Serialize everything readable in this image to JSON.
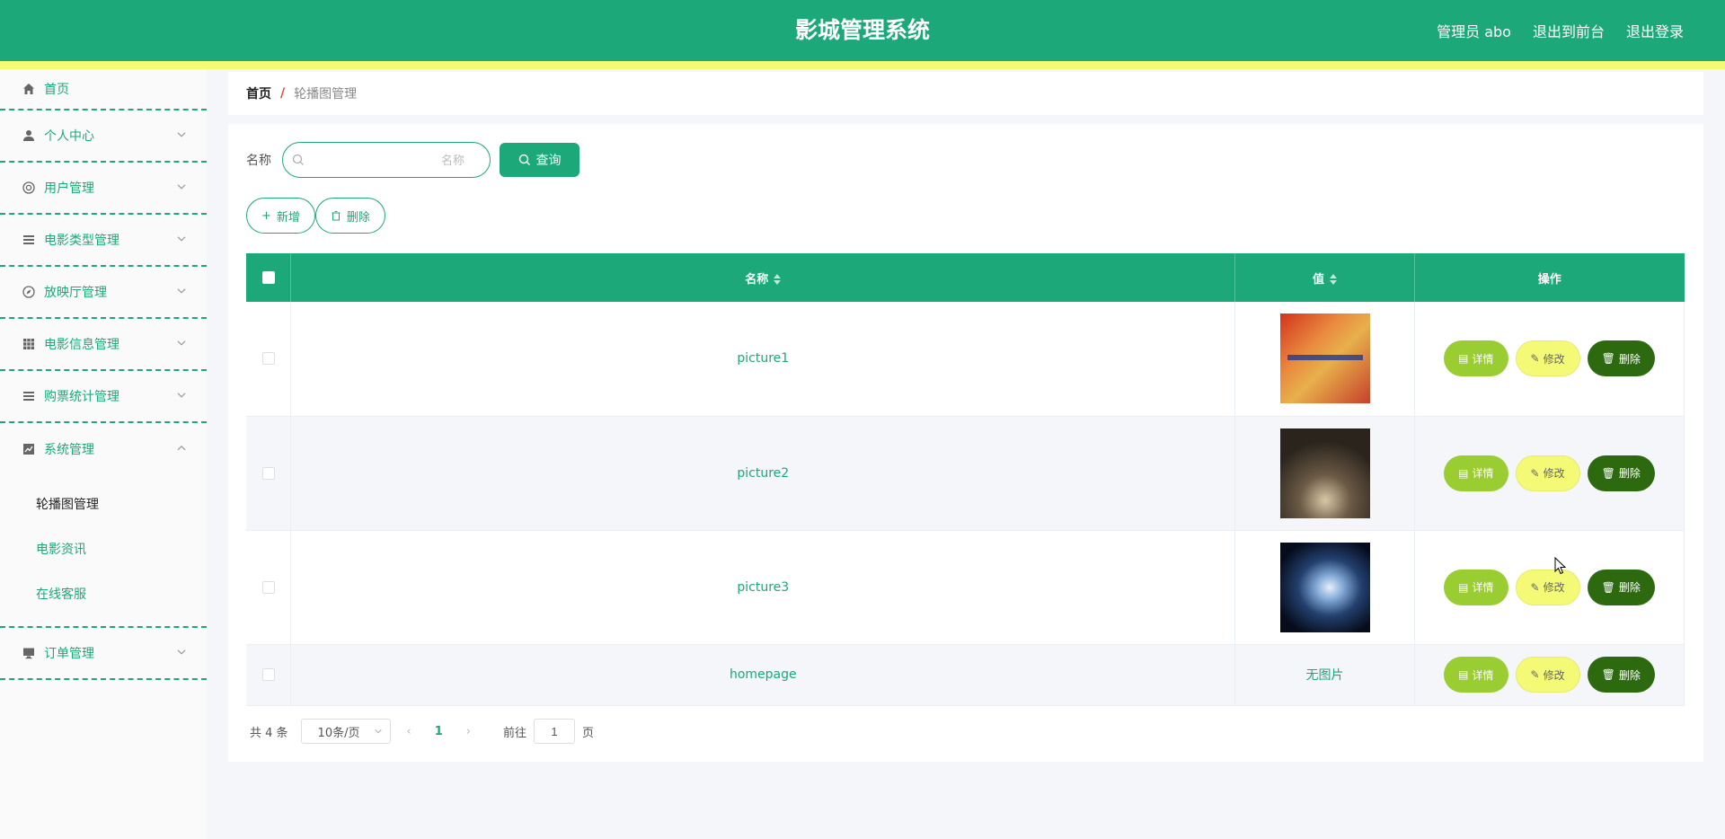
{
  "header": {
    "title": "影城管理系统",
    "user_label": "管理员 abo",
    "to_front_label": "退出到前台",
    "logout_label": "退出登录"
  },
  "sidebar": {
    "items": [
      {
        "label": "首页",
        "icon": "home-icon"
      },
      {
        "label": "个人中心",
        "icon": "user-icon"
      },
      {
        "label": "用户管理",
        "icon": "lifebuoy-icon"
      },
      {
        "label": "电影类型管理",
        "icon": "list-icon"
      },
      {
        "label": "放映厅管理",
        "icon": "compass-icon"
      },
      {
        "label": "电影信息管理",
        "icon": "grid-icon"
      },
      {
        "label": "购票统计管理",
        "icon": "list-icon"
      },
      {
        "label": "系统管理",
        "icon": "chart-icon"
      },
      {
        "label": "订单管理",
        "icon": "monitor-icon"
      }
    ],
    "system_sub": [
      {
        "label": "轮播图管理"
      },
      {
        "label": "电影资讯"
      },
      {
        "label": "在线客服"
      }
    ]
  },
  "breadcrumb": {
    "home": "首页",
    "separator": "/",
    "current": "轮播图管理"
  },
  "search": {
    "label": "名称",
    "placeholder": "名称",
    "query_label": "查询"
  },
  "actions": {
    "add_label": "新增",
    "delete_label": "删除"
  },
  "table": {
    "headers": {
      "name": "名称",
      "value": "值",
      "ops": "操作"
    },
    "rows": [
      {
        "name": "picture1",
        "value": "",
        "has_image": true
      },
      {
        "name": "picture2",
        "value": "",
        "has_image": true
      },
      {
        "name": "picture3",
        "value": "",
        "has_image": true
      },
      {
        "name": "homepage",
        "value": "无图片",
        "has_image": false
      }
    ],
    "op_labels": {
      "detail": "详情",
      "edit": "修改",
      "delete": "删除"
    }
  },
  "pagination": {
    "total_text": "共 4 条",
    "page_size": "10条/页",
    "current_page": "1",
    "goto_label": "前往",
    "goto_value": "1",
    "page_suffix": "页"
  },
  "colors": {
    "primary": "#1ca878",
    "stripe": "#f5fa76",
    "detail_btn": "#9acd32",
    "edit_btn": "#f5fa76",
    "delete_btn": "#2d6a0f"
  }
}
